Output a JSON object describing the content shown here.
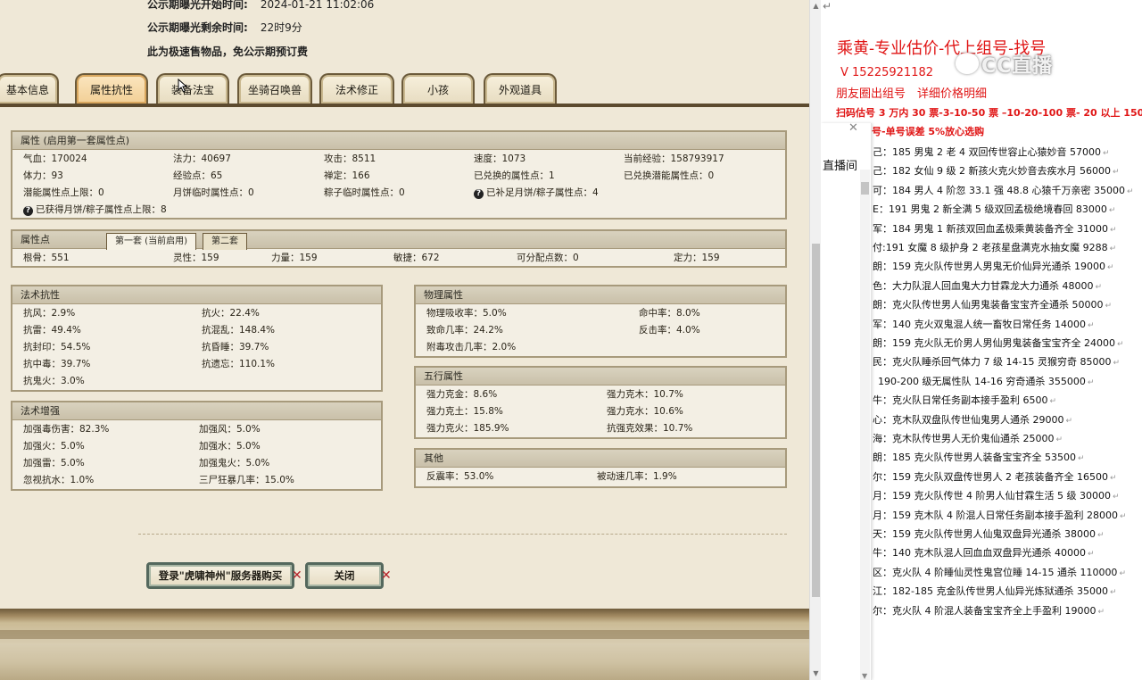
{
  "notice": {
    "start_label": "公示期曝光开始时间:",
    "start_value": "2024-01-21 11:02:06",
    "remain_label": "公示期曝光剩余时间:",
    "remain_value": "22时9分",
    "fast_sale": "此为极速售物品，免公示期预订费"
  },
  "tabs": [
    {
      "label": "基本信息"
    },
    {
      "label": "属性抗性"
    },
    {
      "label": "装备法宝"
    },
    {
      "label": "坐骑召唤兽"
    },
    {
      "label": "法术修正"
    },
    {
      "label": "小孩"
    },
    {
      "label": "外观道具"
    }
  ],
  "attr_panel": {
    "title": "属性 (启用第一套属性点)",
    "rows": [
      [
        "气血：170024",
        "法力：40697",
        "攻击：8511",
        "速度：1073",
        "当前经验：158793917"
      ],
      [
        "体力：93",
        "经验点：65",
        "禅定：166",
        "已兑换的属性点：1",
        "已兑换潜能属性点：0"
      ],
      [
        "潜能属性点上限：0",
        "月饼临时属性点：0",
        "粽子临时属性点：0",
        "已补足月饼/粽子属性点：4"
      ]
    ],
    "footer": "已获得月饼/粽子属性点上限：8"
  },
  "points_panel": {
    "title": "属性点",
    "subtabs": [
      "第一套 (当前启用)",
      "第二套"
    ],
    "values": [
      "根骨：551",
      "灵性：159",
      "力量：159",
      "敏捷：672",
      "可分配点数：0",
      "定力：159"
    ]
  },
  "resist_panel": {
    "title": "法术抗性",
    "rows": [
      [
        "抗风：2.9%",
        "抗火：22.4%"
      ],
      [
        "抗雷：49.4%",
        "抗混乱：148.4%"
      ],
      [
        "抗封印：54.5%",
        "抗昏睡：39.7%"
      ],
      [
        "抗中毒：39.7%",
        "抗遗忘：110.1%"
      ],
      [
        "抗鬼火：3.0%"
      ]
    ]
  },
  "boost_panel": {
    "title": "法术增强",
    "rows": [
      [
        "加强毒伤害：82.3%",
        "加强风：5.0%"
      ],
      [
        "加强火：5.0%",
        "加强水：5.0%"
      ],
      [
        "加强雷：5.0%",
        "加强鬼火：5.0%"
      ],
      [
        "忽视抗水：1.0%",
        "三尸狂暴几率：15.0%"
      ]
    ]
  },
  "physical_panel": {
    "title": "物理属性",
    "rows": [
      [
        "物理吸收率：5.0%",
        "命中率：8.0%"
      ],
      [
        "致命几率：24.2%",
        "反击率：4.0%"
      ],
      [
        "附毒攻击几率：2.0%"
      ]
    ]
  },
  "five_panel": {
    "title": "五行属性",
    "rows": [
      [
        "强力克金：8.6%",
        "强力克木：10.7%"
      ],
      [
        "强力克土：15.8%",
        "强力克水：10.6%"
      ],
      [
        "强力克火：185.9%",
        "抗强克效果：10.7%"
      ]
    ]
  },
  "other_panel": {
    "title": "其他",
    "rows": [
      [
        "反震率：53.0%",
        "被动速几率：1.9%"
      ]
    ]
  },
  "buttons": {
    "login_buy": "登录\"虎啸神州\"服务器购买",
    "close": "关闭"
  },
  "doc": {
    "title": "乘黄-专业估价-代上组号-找号",
    "phone": "V 15225921182",
    "subtitle": "朋友圈出组号　详细价格明细",
    "price_line": "扫码估号 3 万内 30 票-3-10-50 票 –10-20-100 票- 20 以上 150",
    "price_line2": "号-单号误差 5%放心选购",
    "overlay_label": "直播间",
    "watermark": "CC直播",
    "listings": [
      "己：185 男鬼 2 老 4 双回传世容止心猿妙音 57000",
      "己：182 女仙 9 级 2 新孩火克火妙音去疾水月 56000",
      "可：184 男人 4 阶忽 33.1 强 48.8 心猿千万亲密 35000",
      "E：191 男鬼 2 新全满 5 级双回孟极绝境春回 83000",
      "军：184 男鬼 1 新孩双回血孟极乘黄装备齐全 31000",
      "付:191 女魔 8 级护身 2 老孩星盘满克水抽女魔 9288",
      "朗：159 克火队传世男人男鬼无价仙异光通杀 19000",
      "色：大力队混人回血鬼大力甘霖龙大力通杀 48000",
      "朗：克火队传世男人仙男鬼装备宝宝齐全通杀 50000",
      "军：140 克火双鬼混人统一畜牧日常任务 14000",
      "朗：159 克火队无价男人男仙男鬼装备宝宝齐全 24000",
      "民：克火队睡杀回气体力 7 级 14-15 灵猴穷奇 85000",
      "190-200 级无属性队 14-16 穷奇通杀 355000",
      "牛：克火队日常任务副本接手盈利 6500",
      "心：克木队双盘队传世仙鬼男人通杀 29000",
      "海：克木队传世男人无价鬼仙通杀 25000",
      "朗：185 克火队传世男人装备宝宝齐全 53500",
      "尔：159 克火队双盘传世男人 2 老孩装备齐全 16500",
      "月：159 克火队传世 4 阶男人仙甘霖生活 5 级 30000",
      "月：159 克木队 4 阶混人日常任务副本接手盈利 28000",
      "天：159 克火队传世男人仙鬼双盘异光通杀 38000",
      "牛：140 克木队混人回血血双盘异光通杀 40000",
      "区：克火队 4 阶睡仙灵性鬼宫位睡 14-15 通杀 110000",
      "江：182-185 克金队传世男人仙异光炼狱通杀 35000",
      "尔：克火队 4 阶混人装备宝宝齐全上手盈利 19000"
    ]
  },
  "colors": {
    "doc_red": "#e01515",
    "tab_border": "#6b5a3a",
    "panel_header": "#c9c0a9",
    "button_border": "#54685d"
  }
}
